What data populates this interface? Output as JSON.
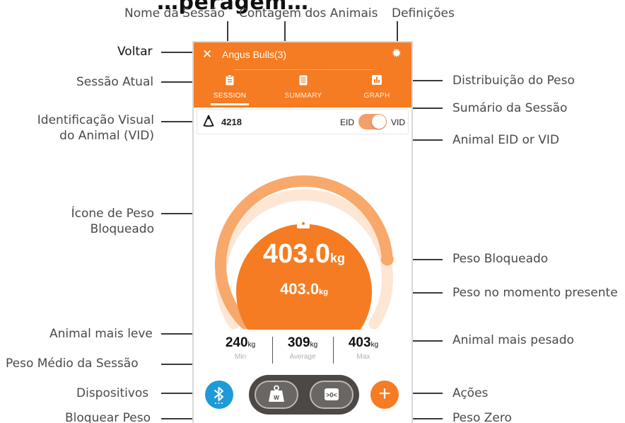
{
  "page_title": "…peragem…",
  "annotations": {
    "session_name": "Nome da Sessão",
    "animal_count": "Contagem dos Animais",
    "settings": "Definições",
    "back": "Voltar",
    "current_session": "Sessão Atual",
    "weight_distribution": "Distribuição do Peso",
    "session_summary": "Sumário da Sessão",
    "visual_id_line1": "Identificação Visual",
    "visual_id_line2": "do Animal (VID)",
    "animal_eid_vid": "Animal EID or VID",
    "locked_weight_icon_line1": "Ícone de Peso",
    "locked_weight_icon_line2": "Bloqueado",
    "locked_weight": "Peso Bloqueado",
    "current_weight": "Peso no momento presente",
    "lightest_animal": "Animal mais leve",
    "heaviest_animal": "Animal mais pesado",
    "session_average": "Peso Médio da Sessão",
    "devices": "Dispositivos",
    "actions": "Ações",
    "lock_weight": "Bloquear Peso",
    "zero_weight": "Peso Zero"
  },
  "app": {
    "close_icon": "close-icon",
    "session_title": "Angus Bulls(3)",
    "settings_icon": "gear-icon",
    "tabs": [
      {
        "label": "SESSION",
        "icon": "clipboard-icon",
        "active": true
      },
      {
        "label": "SUMMARY",
        "icon": "document-icon",
        "active": false
      },
      {
        "label": "GRAPH",
        "icon": "bar-chart-icon",
        "active": false
      }
    ],
    "vid_value": "4218",
    "eid_label": "EID",
    "vid_label": "VID",
    "toggle_state": "VID",
    "locked_weight_value": "403.0",
    "locked_weight_unit": "kg",
    "current_weight_value": "403.0",
    "current_weight_unit": "kg",
    "gauge_fill_fraction": 0.82,
    "stats": [
      {
        "value": "240",
        "unit": "kg",
        "caption": "Min"
      },
      {
        "value": "309",
        "unit": "kg",
        "caption": "Average"
      },
      {
        "value": "403",
        "unit": "kg",
        "caption": "Max"
      }
    ],
    "pill_zero_label": ">0<",
    "scale_weight_label": "W",
    "add_label": "+"
  },
  "colors": {
    "accent": "#f57c22",
    "accent_light": "#f8a86a",
    "bluetooth": "#1e9ad6",
    "pill_dark": "#4b4846"
  }
}
